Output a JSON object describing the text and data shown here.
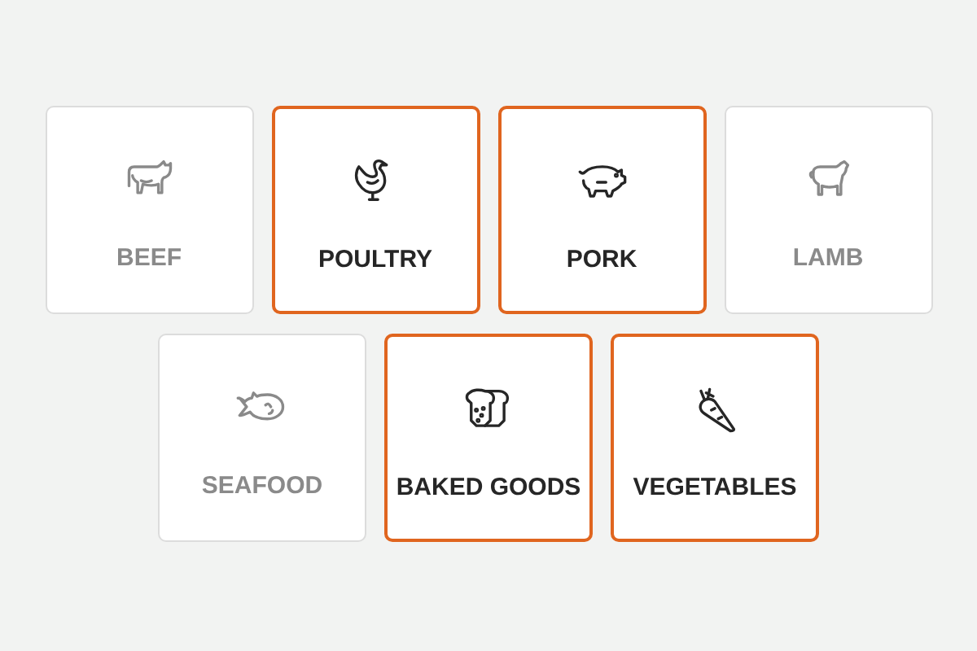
{
  "rows": [
    {
      "items": [
        {
          "label": "BEEF",
          "selected": false,
          "kind": "cow"
        },
        {
          "label": "POULTRY",
          "selected": true,
          "kind": "chicken"
        },
        {
          "label": "PORK",
          "selected": true,
          "kind": "pig"
        },
        {
          "label": "LAMB",
          "selected": false,
          "kind": "sheep"
        }
      ]
    },
    {
      "items": [
        {
          "label": "SEAFOOD",
          "selected": false,
          "kind": "fish"
        },
        {
          "label": "BAKED GOODS",
          "selected": true,
          "kind": "bread"
        },
        {
          "label": "VEGETABLES",
          "selected": true,
          "kind": "carrot"
        }
      ]
    }
  ]
}
